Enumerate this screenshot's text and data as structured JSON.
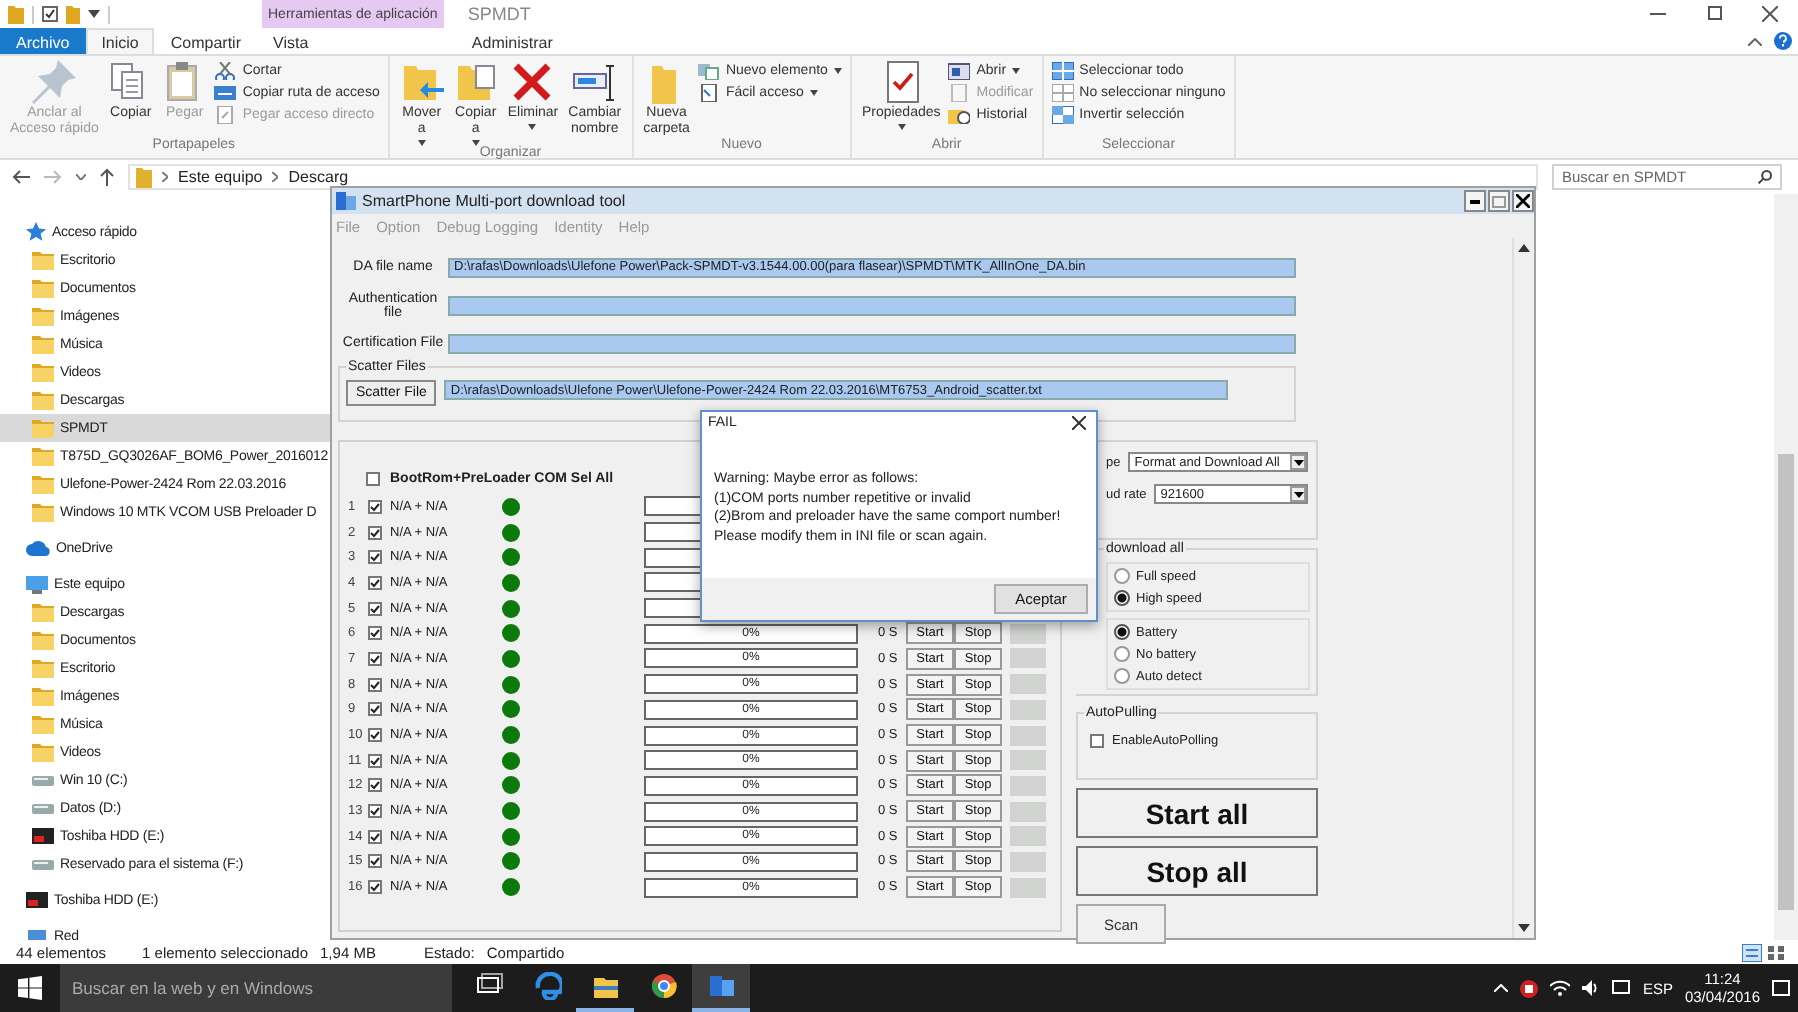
{
  "explorer": {
    "context_tab": "Herramientas de aplicación",
    "title": "SPMDT",
    "tabs": [
      {
        "label": "Archivo",
        "kind": "file",
        "selected": false
      },
      {
        "label": "Inicio",
        "kind": "tab",
        "selected": true
      },
      {
        "label": "Compartir",
        "kind": "tab",
        "selected": false
      },
      {
        "label": "Vista",
        "kind": "tab",
        "selected": false
      },
      {
        "label": "Administrar",
        "kind": "context",
        "selected": false
      }
    ],
    "ribbon": [
      {
        "label": "Portapapeles",
        "items": [
          {
            "label": "Anclar al\nAcceso rápido",
            "kind": "large",
            "disabled": true,
            "dropdown": false
          },
          {
            "label": "Copiar",
            "kind": "large",
            "disabled": false,
            "dropdown": false
          },
          {
            "label": "Pegar",
            "kind": "large",
            "disabled": true,
            "dropdown": false
          },
          {
            "label": "Cortar",
            "kind": "small",
            "disabled": false,
            "dropdown": false
          },
          {
            "label": "Copiar ruta de acceso",
            "kind": "small",
            "disabled": false,
            "dropdown": false
          },
          {
            "label": "Pegar acceso directo",
            "kind": "small",
            "disabled": true,
            "dropdown": false
          }
        ]
      },
      {
        "label": "Organizar",
        "items": [
          {
            "label": "Mover\na",
            "kind": "large",
            "disabled": false,
            "dropdown": true
          },
          {
            "label": "Copiar\na",
            "kind": "large",
            "disabled": false,
            "dropdown": true
          },
          {
            "label": "Eliminar",
            "kind": "large",
            "disabled": false,
            "dropdown": true
          },
          {
            "label": "Cambiar\nnombre",
            "kind": "large",
            "disabled": false,
            "dropdown": false
          }
        ]
      },
      {
        "label": "Nuevo",
        "items": [
          {
            "label": "Nueva\ncarpeta",
            "kind": "large",
            "disabled": false,
            "dropdown": false
          },
          {
            "label": "Nuevo elemento",
            "kind": "small",
            "disabled": false,
            "dropdown": true
          },
          {
            "label": "Fácil acceso",
            "kind": "small",
            "disabled": false,
            "dropdown": true
          }
        ]
      },
      {
        "label": "Abrir",
        "items": [
          {
            "label": "Propiedades",
            "kind": "large",
            "disabled": false,
            "dropdown": true
          },
          {
            "label": "Abrir",
            "kind": "small",
            "disabled": false,
            "dropdown": true
          },
          {
            "label": "Modificar",
            "kind": "small",
            "disabled": true,
            "dropdown": false
          },
          {
            "label": "Historial",
            "kind": "small",
            "disabled": false,
            "dropdown": false
          }
        ]
      },
      {
        "label": "Seleccionar",
        "items": [
          {
            "label": "Seleccionar todo",
            "kind": "small",
            "disabled": false,
            "dropdown": false
          },
          {
            "label": "No seleccionar ninguno",
            "kind": "small",
            "disabled": false,
            "dropdown": false
          },
          {
            "label": "Invertir selección",
            "kind": "small",
            "disabled": false,
            "dropdown": false
          }
        ]
      }
    ],
    "breadcrumb": [
      "Este equipo",
      "Descarg"
    ],
    "search": {
      "placeholder": "Buscar en SPMDT"
    },
    "nav": [
      {
        "label": "Acceso rápido",
        "kind": "star",
        "selected": false,
        "children": [
          {
            "label": "Escritorio",
            "kind": "folder",
            "selected": false
          },
          {
            "label": "Documentos",
            "kind": "folder",
            "selected": false
          },
          {
            "label": "Imágenes",
            "kind": "folder",
            "selected": false
          },
          {
            "label": "Música",
            "kind": "folder",
            "selected": false
          },
          {
            "label": "Videos",
            "kind": "folder",
            "selected": false
          },
          {
            "label": "Descargas",
            "kind": "folder",
            "selected": false
          },
          {
            "label": "SPMDT",
            "kind": "folder",
            "selected": true
          },
          {
            "label": "T875D_GQ3026AF_BOM6_Power_2016012",
            "kind": "folder",
            "selected": false
          },
          {
            "label": "Ulefone-Power-2424 Rom 22.03.2016",
            "kind": "folder",
            "selected": false
          },
          {
            "label": "Windows 10 MTK VCOM USB Preloader D",
            "kind": "folder",
            "selected": false
          }
        ]
      },
      {
        "label": "OneDrive",
        "kind": "cloud",
        "selected": false
      },
      {
        "label": "Este equipo",
        "kind": "computer",
        "selected": false,
        "children": [
          {
            "label": "Descargas",
            "kind": "folder",
            "selected": false
          },
          {
            "label": "Documentos",
            "kind": "folder",
            "selected": false
          },
          {
            "label": "Escritorio",
            "kind": "folder",
            "selected": false
          },
          {
            "label": "Imágenes",
            "kind": "folder",
            "selected": false
          },
          {
            "label": "Música",
            "kind": "folder",
            "selected": false
          },
          {
            "label": "Videos",
            "kind": "folder",
            "selected": false
          },
          {
            "label": "Win 10  (C:)",
            "kind": "drive",
            "selected": false
          },
          {
            "label": "Datos (D:)",
            "kind": "drive",
            "selected": false
          },
          {
            "label": "Toshiba HDD (E:)",
            "kind": "external",
            "selected": false
          },
          {
            "label": "Reservado para el sistema (F:)",
            "kind": "drive",
            "selected": false
          }
        ]
      },
      {
        "label": "Toshiba HDD (E:)",
        "kind": "external",
        "selected": false
      },
      {
        "label": "Red",
        "kind": "network",
        "selected": false
      }
    ],
    "status_bar": [
      "44 elementos",
      "1 elemento seleccionado",
      "1,94 MB",
      "Estado:",
      "Compartido"
    ]
  },
  "tool": {
    "title": "SmartPhone Multi-port download tool",
    "menu": [
      "File",
      "Option",
      "Debug Logging",
      "Identity",
      "Help"
    ],
    "fields": [
      {
        "label": "DA file name",
        "value": "D:\\rafas\\Downloads\\Ulefone Power\\Pack-SPMDT-v3.1544.00.00(para flasear)\\SPMDT\\MTK_AllInOne_DA.bin"
      },
      {
        "label": "Authentication file"
      },
      {
        "label": "Certification File"
      }
    ],
    "scatter": {
      "title": "Scatter Files",
      "button": "Scatter File",
      "value": "D:\\rafas\\Downloads\\Ulefone Power\\Ulefone-Power-2424 Rom 22.03.2016\\MT6753_Android_scatter.txt"
    },
    "select_all": {
      "label": "BootRom+PreLoader COM Sel All",
      "checked": false
    },
    "rows": [
      {
        "number": "1",
        "checked": true,
        "port": "N/A + N/A",
        "color": "#0b7a0b"
      },
      {
        "number": "2",
        "checked": true,
        "port": "N/A + N/A",
        "color": "#0b7a0b"
      },
      {
        "number": "3",
        "checked": true,
        "port": "N/A + N/A",
        "color": "#0b7a0b"
      },
      {
        "number": "4",
        "checked": true,
        "port": "N/A + N/A",
        "color": "#0b7a0b"
      },
      {
        "number": "5",
        "checked": true,
        "port": "N/A + N/A",
        "color": "#0b7a0b"
      },
      {
        "number": "6",
        "checked": true,
        "port": "N/A + N/A",
        "color": "#0b7a0b",
        "progress": "0%",
        "time": "0 S",
        "buttons": [
          "Start",
          "Stop"
        ]
      },
      {
        "number": "7",
        "checked": true,
        "port": "N/A + N/A",
        "color": "#0b7a0b",
        "progress": "0%",
        "time": "0 S",
        "buttons": [
          "Start",
          "Stop"
        ]
      },
      {
        "number": "8",
        "checked": true,
        "port": "N/A + N/A",
        "color": "#0b7a0b",
        "progress": "0%",
        "time": "0 S",
        "buttons": [
          "Start",
          "Stop"
        ]
      },
      {
        "number": "9",
        "checked": true,
        "port": "N/A + N/A",
        "color": "#0b7a0b",
        "progress": "0%",
        "time": "0 S",
        "buttons": [
          "Start",
          "Stop"
        ]
      },
      {
        "number": "10",
        "checked": true,
        "port": "N/A + N/A",
        "color": "#0b7a0b",
        "progress": "0%",
        "time": "0 S",
        "buttons": [
          "Start",
          "Stop"
        ]
      },
      {
        "number": "11",
        "checked": true,
        "port": "N/A + N/A",
        "color": "#0b7a0b",
        "progress": "0%",
        "time": "0 S",
        "buttons": [
          "Start",
          "Stop"
        ]
      },
      {
        "number": "12",
        "checked": true,
        "port": "N/A + N/A",
        "color": "#0b7a0b",
        "progress": "0%",
        "time": "0 S",
        "buttons": [
          "Start",
          "Stop"
        ]
      },
      {
        "number": "13",
        "checked": true,
        "port": "N/A + N/A",
        "color": "#0b7a0b",
        "progress": "0%",
        "time": "0 S",
        "buttons": [
          "Start",
          "Stop"
        ]
      },
      {
        "number": "14",
        "checked": true,
        "port": "N/A + N/A",
        "color": "#0b7a0b",
        "progress": "0%",
        "time": "0 S",
        "buttons": [
          "Start",
          "Stop"
        ]
      },
      {
        "number": "15",
        "checked": true,
        "port": "N/A + N/A",
        "color": "#0b7a0b",
        "progress": "0%",
        "time": "0 S",
        "buttons": [
          "Start",
          "Stop"
        ]
      },
      {
        "number": "16",
        "checked": true,
        "port": "N/A + N/A",
        "color": "#0b7a0b",
        "progress": "0%",
        "time": "0 S",
        "buttons": [
          "Start",
          "Stop"
        ]
      }
    ],
    "type": {
      "label": "pe",
      "value": "Format and Download All"
    },
    "baud": {
      "label": "ud rate",
      "value": "921600"
    },
    "download_group": "download all",
    "speed": [
      {
        "label": "Full speed",
        "selected": false
      },
      {
        "label": "High speed",
        "selected": true
      }
    ],
    "power": [
      {
        "label": "Battery",
        "selected": true
      },
      {
        "label": "No battery",
        "selected": false
      },
      {
        "label": "Auto detect",
        "selected": false
      }
    ],
    "autopolling": {
      "title": "AutoPulling",
      "label": "EnableAutoPolling",
      "checked": false
    },
    "buttons": [
      {
        "label": "Start all",
        "kind": "big"
      },
      {
        "label": "Stop all",
        "kind": "big"
      },
      {
        "label": "Scan",
        "kind": "small"
      }
    ]
  },
  "dialog": {
    "title": "FAIL",
    "message": "Warning: Maybe error as follows:\n(1)COM ports number repetitive or invalid\n(2)Brom and preloader have the same comport number!\nPlease modify them in INI file or scan again.",
    "button": "Aceptar"
  },
  "taskbar": {
    "search": {
      "placeholder": "Buscar en la web y en Windows"
    },
    "apps": [
      {
        "active": false
      },
      {
        "active": false
      },
      {
        "active": true
      },
      {
        "active": false
      },
      {
        "active": true
      }
    ],
    "language": "ESP",
    "time": "11:24",
    "date": "03/04/2016"
  }
}
